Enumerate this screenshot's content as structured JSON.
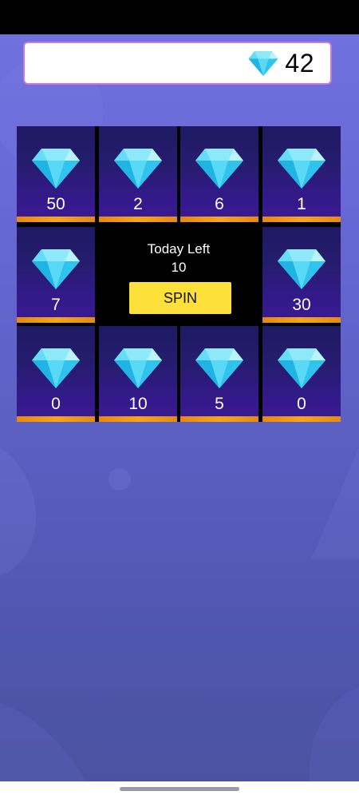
{
  "balance": {
    "icon": "diamond-icon",
    "amount": "42"
  },
  "grid": {
    "cells": [
      {
        "value": "50",
        "icon": "diamond-icon"
      },
      {
        "value": "2",
        "icon": "diamond-icon"
      },
      {
        "value": "6",
        "icon": "diamond-icon"
      },
      {
        "value": "1",
        "icon": "diamond-icon"
      },
      {
        "value": "7",
        "icon": "diamond-icon"
      },
      {
        "value": "30",
        "icon": "diamond-icon"
      },
      {
        "value": "0",
        "icon": "diamond-icon"
      },
      {
        "value": "10",
        "icon": "diamond-icon"
      },
      {
        "value": "5",
        "icon": "diamond-icon"
      },
      {
        "value": "0",
        "icon": "diamond-icon"
      }
    ]
  },
  "spin_panel": {
    "label": "Today Left",
    "count": "10",
    "button_label": "SPIN"
  },
  "colors": {
    "accent": "#fde03a",
    "tile_orange": "#f7a51a",
    "diamond": "#3fd0f5"
  }
}
